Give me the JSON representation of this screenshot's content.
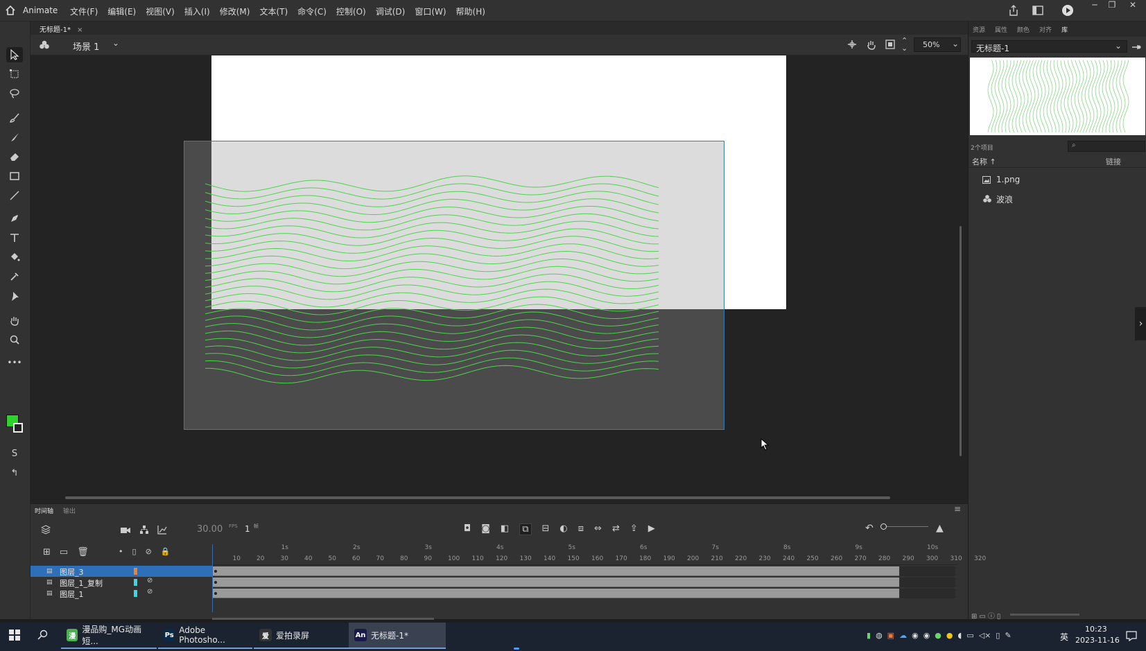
{
  "app": {
    "name": "Animate",
    "menu": [
      "文件(F)",
      "编辑(E)",
      "视图(V)",
      "插入(I)",
      "修改(M)",
      "文本(T)",
      "命令(C)",
      "控制(O)",
      "调试(D)",
      "窗口(W)",
      "帮助(H)"
    ]
  },
  "document": {
    "tab_label": "无标题-1*",
    "scene_label": "场景 1",
    "zoom": "50%"
  },
  "right_panel": {
    "tabs": [
      "资源",
      "属性",
      "颜色",
      "对齐",
      "库"
    ],
    "library_doc": "无标题-1",
    "item_count": "2个项目",
    "col_name": "名称 ↑",
    "col_link": "链接",
    "items": [
      {
        "name": "1.png",
        "icon": "bitmap-icon"
      },
      {
        "name": "波浪",
        "icon": "movieclip-icon"
      }
    ]
  },
  "timeline": {
    "tabs": [
      "时间轴",
      "输出"
    ],
    "fps": "30.00",
    "fps_unit": "FPS",
    "frame": "1",
    "frame_unit": "帧",
    "seconds": [
      "1s",
      "2s",
      "3s",
      "4s",
      "5s",
      "6s",
      "7s",
      "8s",
      "9s",
      "10s"
    ],
    "frames": [
      "10",
      "20",
      "30",
      "40",
      "50",
      "60",
      "70",
      "80",
      "90",
      "100",
      "110",
      "120",
      "130",
      "140",
      "150",
      "160",
      "170",
      "180",
      "190",
      "200",
      "210",
      "220",
      "230",
      "240",
      "250",
      "260",
      "270",
      "280",
      "290",
      "300",
      "310",
      "320"
    ],
    "layers": [
      {
        "name": "图层_3",
        "color": "#f0822a",
        "selected": true,
        "hidden": false
      },
      {
        "name": "图层_1_复制",
        "color": "#36d6e6",
        "selected": false,
        "hidden": true
      },
      {
        "name": "图层_1",
        "color": "#36d6e6",
        "selected": false,
        "hidden": true
      }
    ]
  },
  "colors": {
    "fill": "#2fd12f",
    "wave": "#4cd44c"
  },
  "taskbar": {
    "apps": [
      {
        "label": "漫品购_MG动画短...",
        "icon": "漫",
        "color": "#4caf50"
      },
      {
        "label": "Adobe Photosho...",
        "icon": "Ps",
        "color": "#0a2a4a"
      },
      {
        "label": "爱拍录屏",
        "icon": "爱",
        "color": "#333"
      },
      {
        "label": "无标题-1*",
        "icon": "An",
        "color": "#1a1a4a"
      }
    ],
    "ime": "英",
    "time": "10:23",
    "date": "2023-11-16"
  }
}
